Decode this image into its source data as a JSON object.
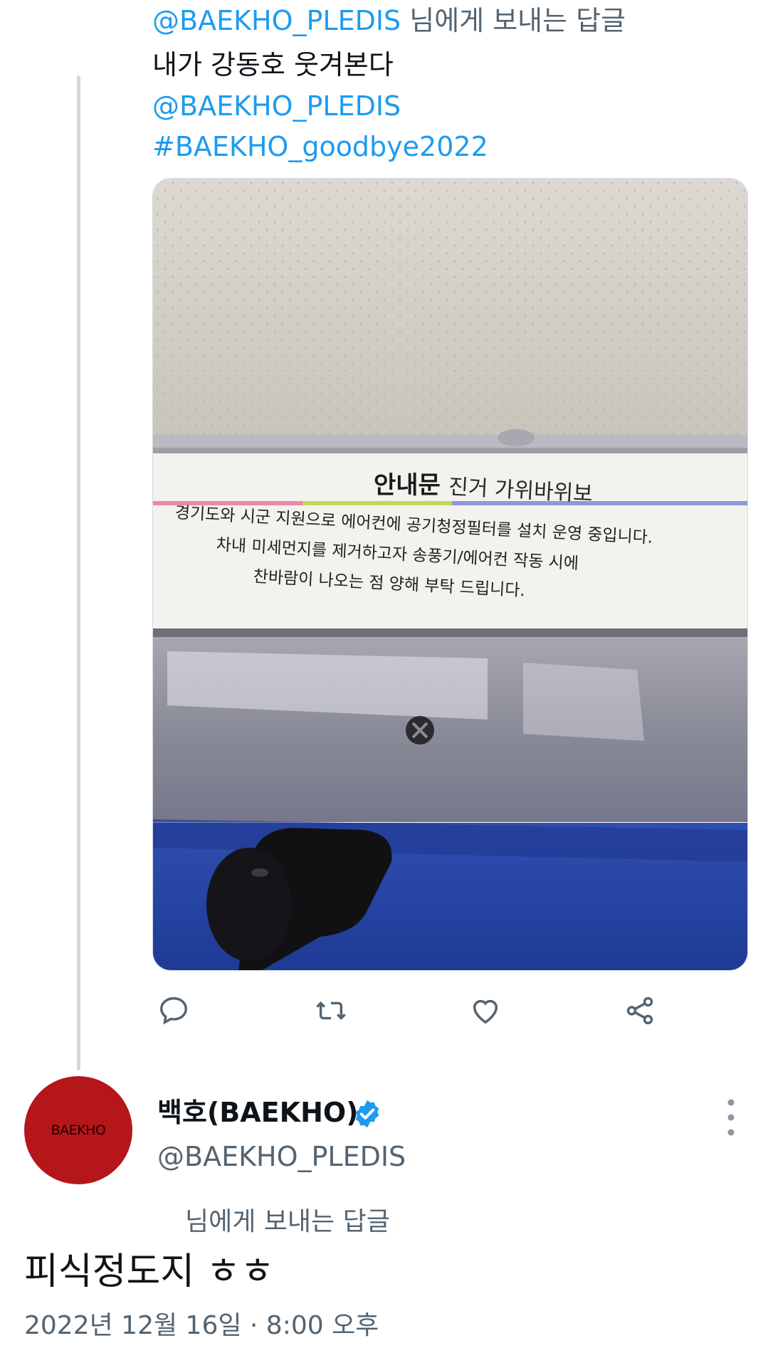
{
  "parent_tweet": {
    "reply_to_handle": "@BAEKHO_PLEDIS",
    "reply_to_suffix": " 님에게 보내는 답글",
    "text": "내가 강동호 웃겨본다",
    "mention": "@BAEKHO_PLEDIS",
    "hashtag": "#BAEKHO_goodbye2022",
    "media": {
      "sign_title": "안내문",
      "sign_handwriting": "진거 가위바위보",
      "sign_line1": "경기도와 시군 지원으로 에어컨에 공기청정필터를 설치 운영 중입니다.",
      "sign_line2": "차내 미세먼지를 제거하고자 송풍기/에어컨 작동 시에",
      "sign_line3": "찬바람이 나오는 점 양해 부탁 드립니다."
    },
    "actions": [
      "reply-icon",
      "retweet-icon",
      "like-icon",
      "share-icon"
    ]
  },
  "author": {
    "avatar_text": "BAEKHO",
    "name": "백호(BAEKHO)",
    "handle": "@BAEKHO_PLEDIS",
    "verified_color": "#1d9bf0"
  },
  "reply": {
    "reply_to_suffix": "님에게 보내는 답글",
    "text": "피식정도지 ㅎㅎ",
    "timestamp": "2022년 12월 16일 · 8:00 오후"
  },
  "colors": {
    "link": "#1d9bf0",
    "secondary": "#536471",
    "avatar_bg": "#b5161a"
  }
}
